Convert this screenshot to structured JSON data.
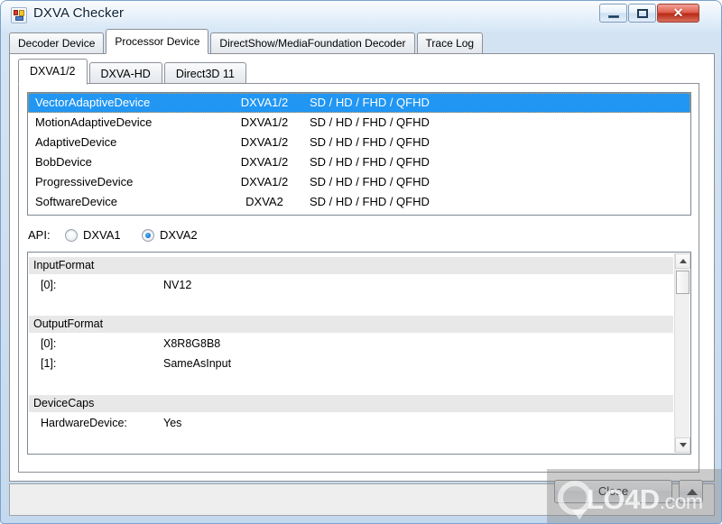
{
  "window": {
    "title": "DXVA Checker",
    "icon": "app-squares-icon",
    "caption_buttons": {
      "minimize": "–",
      "maximize": "□",
      "close": "✕"
    }
  },
  "outer_tabs": [
    {
      "label": "Decoder Device",
      "selected": false
    },
    {
      "label": "Processor Device",
      "selected": true
    },
    {
      "label": "DirectShow/MediaFoundation Decoder",
      "selected": false
    },
    {
      "label": "Trace Log",
      "selected": false
    }
  ],
  "inner_tabs": [
    {
      "label": "DXVA1/2",
      "selected": true
    },
    {
      "label": "DXVA-HD",
      "selected": false
    },
    {
      "label": "Direct3D 11",
      "selected": false
    }
  ],
  "device_list": {
    "rows": [
      {
        "name": "VectorAdaptiveDevice",
        "api": "DXVA1/2",
        "resolutions": "SD / HD / FHD / QFHD",
        "selected": true
      },
      {
        "name": "MotionAdaptiveDevice",
        "api": "DXVA1/2",
        "resolutions": "SD / HD / FHD / QFHD",
        "selected": false
      },
      {
        "name": "AdaptiveDevice",
        "api": "DXVA1/2",
        "resolutions": "SD / HD / FHD / QFHD",
        "selected": false
      },
      {
        "name": "BobDevice",
        "api": "DXVA1/2",
        "resolutions": "SD / HD / FHD / QFHD",
        "selected": false
      },
      {
        "name": "ProgressiveDevice",
        "api": "DXVA1/2",
        "resolutions": "SD / HD / FHD / QFHD",
        "selected": false
      },
      {
        "name": "SoftwareDevice",
        "api": "DXVA2",
        "resolutions": "SD / HD / FHD / QFHD",
        "selected": false
      }
    ]
  },
  "api_row": {
    "label": "API:",
    "options": [
      {
        "label": "DXVA1",
        "selected": false
      },
      {
        "label": "DXVA2",
        "selected": true
      }
    ]
  },
  "details": {
    "groups": [
      {
        "header": "InputFormat",
        "items": [
          {
            "key": "[0]:",
            "value": "NV12"
          }
        ]
      },
      {
        "header": "OutputFormat",
        "items": [
          {
            "key": "[0]:",
            "value": "X8R8G8B8"
          },
          {
            "key": "[1]:",
            "value": "SameAsInput"
          }
        ]
      },
      {
        "header": "DeviceCaps",
        "items": [
          {
            "key": "HardwareDevice:",
            "value": "Yes"
          }
        ]
      }
    ]
  },
  "footer": {
    "close_label": "Close",
    "size_grip_icon": "triangle-up-icon"
  },
  "watermark": {
    "brand": "LO4D",
    "suffix": ".com"
  },
  "colors": {
    "selection": "#2196f3",
    "group_header": "#e8e8e8",
    "frame": "#c5d9ee",
    "close_button_red": "#b92a16"
  }
}
